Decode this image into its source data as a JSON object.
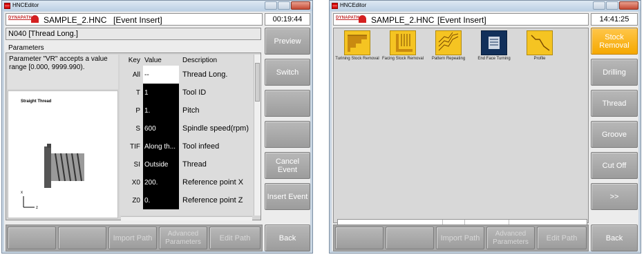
{
  "left": {
    "window_title": "HNCEditor",
    "logo": "DYNAPATH",
    "file": "SAMPLE_2.HNC",
    "mode": "[Event Insert]",
    "time": "00:19:44",
    "block": "N040 [Thread Long.]",
    "params_label": "Parameters",
    "hint": "Parameter \"VR\" accepts a value range [0.000, 9999.990).",
    "image_caption": "Straight Thread",
    "table_headers": {
      "key": "Key",
      "value": "Value",
      "desc": "Description"
    },
    "rows": [
      {
        "key": "All",
        "value": "--",
        "desc": "Thread Long."
      },
      {
        "key": "T",
        "value": "1",
        "desc": "Tool ID"
      },
      {
        "key": "P",
        "value": "1.",
        "desc": "Pitch"
      },
      {
        "key": "S",
        "value": "600",
        "desc": "Spindle speed(rpm)"
      },
      {
        "key": "TIF",
        "value": "Along th...",
        "desc": "Tool infeed"
      },
      {
        "key": "SI",
        "value": "Outside",
        "desc": "Thread"
      },
      {
        "key": "X0",
        "value": "200.",
        "desc": "Reference point X"
      },
      {
        "key": "Z0",
        "value": "0.",
        "desc": "Reference point Z"
      }
    ],
    "side_buttons": [
      "Preview",
      "Switch",
      "",
      "",
      "Cancel Event",
      "Insert Event"
    ],
    "bottom_buttons": [
      "",
      "",
      "Import Path",
      "Advanced Parameters",
      "Edit Path"
    ],
    "back": "Back"
  },
  "right": {
    "window_title": "HNCEditor",
    "logo": "DYNAPATH",
    "file": "SAMPLE_2.HNC",
    "mode": "[Event Insert]",
    "time": "14:41:25",
    "events": [
      {
        "label": "Turining Stock Removal",
        "icon": "turning-stock-icon"
      },
      {
        "label": "Facing Stock Removal",
        "icon": "facing-stock-icon"
      },
      {
        "label": "Pattern Repeating",
        "icon": "pattern-repeat-icon"
      },
      {
        "label": "End Face Turning",
        "icon": "end-face-icon"
      },
      {
        "label": "Profile",
        "icon": "profile-icon"
      }
    ],
    "side_buttons": [
      "Stock Removal",
      "Drilling",
      "Thread",
      "Groove",
      "Cut Off",
      ">>"
    ],
    "bottom_buttons": [
      "",
      "",
      "Import Path",
      "Advanced Parameters",
      "Edit Path"
    ],
    "back": "Back",
    "active_color": "#f5a800"
  }
}
